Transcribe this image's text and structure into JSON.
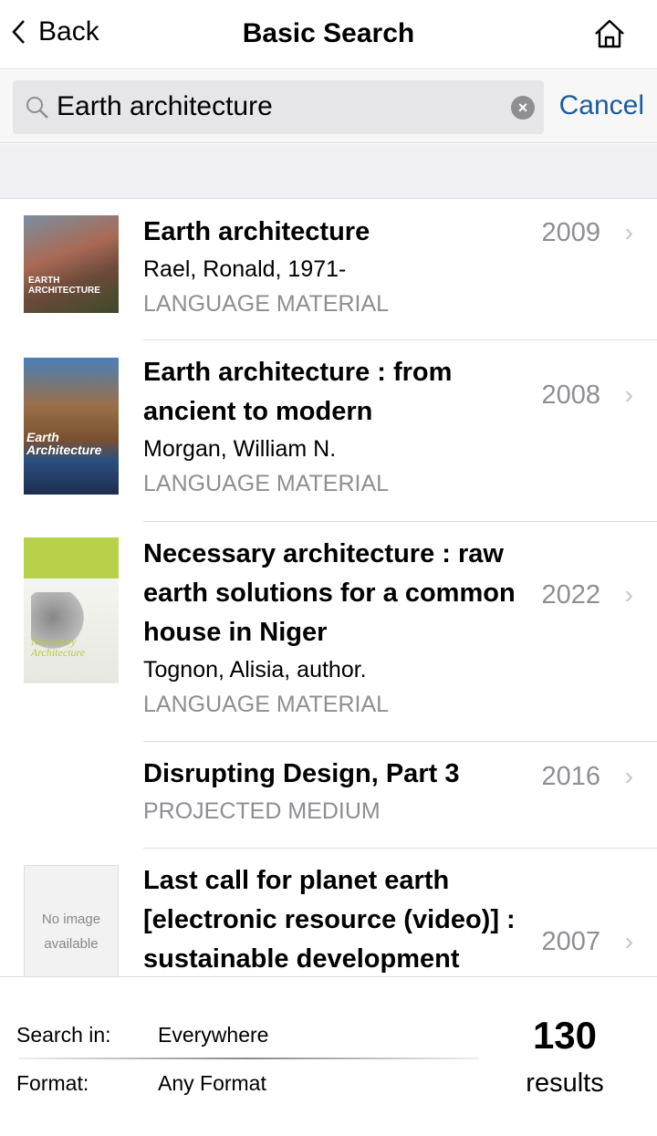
{
  "header": {
    "back_label": "Back",
    "title": "Basic Search",
    "home_icon": "home-icon"
  },
  "search": {
    "value": "Earth architecture",
    "cancel_label": "Cancel"
  },
  "results": [
    {
      "title": "Earth architecture",
      "author": "Rael, Ronald, 1971-",
      "format": "LANGUAGE MATERIAL",
      "year": "2009",
      "cover_text": "EARTH ARCHITECTURE"
    },
    {
      "title": "Earth architecture : from ancient to modern",
      "author": "Morgan, William N.",
      "format": "LANGUAGE MATERIAL",
      "year": "2008",
      "cover_text": "Earth Architecture"
    },
    {
      "title": "Necessary architecture : raw earth solutions for a common house in Niger",
      "author": "Tognon, Alisia, author.",
      "format": "LANGUAGE MATERIAL",
      "year": "2022",
      "cover_text": "Necessary Architecture"
    },
    {
      "title": "Disrupting Design, Part 3",
      "format": "PROJECTED MEDIUM",
      "year": "2016"
    },
    {
      "title": "Last call for planet earth [electronic resource (video)] : sustainable development",
      "year": "2007",
      "cover_text": "No image available"
    }
  ],
  "footer": {
    "search_in_label": "Search in:",
    "search_in_value": "Everywhere",
    "format_label": "Format:",
    "format_value": "Any Format",
    "count": "130",
    "count_label": "results"
  },
  "colors": {
    "accent": "#1b5c9a",
    "secondary_text": "#8e8e93"
  }
}
